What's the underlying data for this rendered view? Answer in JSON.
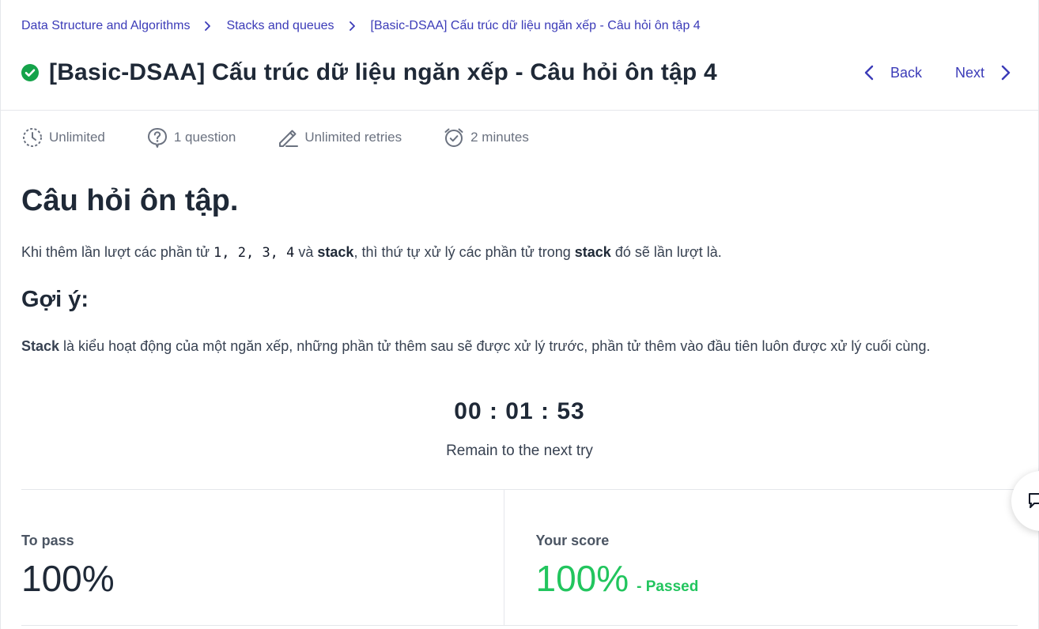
{
  "breadcrumb": {
    "items": [
      "Data Structure and Algorithms",
      "Stacks and queues",
      "[Basic-DSAA] Cấu trúc dữ liệu ngăn xếp - Câu hỏi ôn tập 4"
    ]
  },
  "header": {
    "title": "[Basic-DSAA] Cấu trúc dữ liệu ngăn xếp - Câu hỏi ôn tập 4",
    "status_icon": "check-circle-icon",
    "back_label": "Back",
    "next_label": "Next"
  },
  "meta": [
    {
      "icon": "clock-icon",
      "label": "Unlimited"
    },
    {
      "icon": "question-icon",
      "label": "1 question"
    },
    {
      "icon": "pencil-icon",
      "label": "Unlimited retries"
    },
    {
      "icon": "alarm-icon",
      "label": "2 minutes"
    }
  ],
  "content": {
    "heading": "Câu hỏi ôn tập.",
    "question": {
      "prefix": "Khi thêm lần lượt các phần tử ",
      "code": "1, 2, 3, 4",
      "mid1": " và ",
      "bold1": "stack",
      "mid2": ", thì thứ tự xử lý các phần tử trong ",
      "bold2": "stack",
      "suffix": " đó sẽ lần lượt là."
    },
    "hint_heading": "Gợi ý:",
    "hint": {
      "bold": "Stack",
      "text": " là kiểu hoạt động của một ngăn xếp, những phần tử thêm sau sẽ được xử lý trước, phần tử thêm vào đầu tiên luôn được xử lý cuối cùng."
    }
  },
  "timer": {
    "value": "00 : 01 : 53",
    "label": "Remain to the next try"
  },
  "score": {
    "to_pass_label": "To pass",
    "to_pass_value": "100%",
    "your_score_label": "Your score",
    "your_score_value": "100%",
    "status": "- Passed"
  },
  "colors": {
    "link": "#3b3bb8",
    "pass": "#22c55e",
    "check": "#15a34a"
  }
}
